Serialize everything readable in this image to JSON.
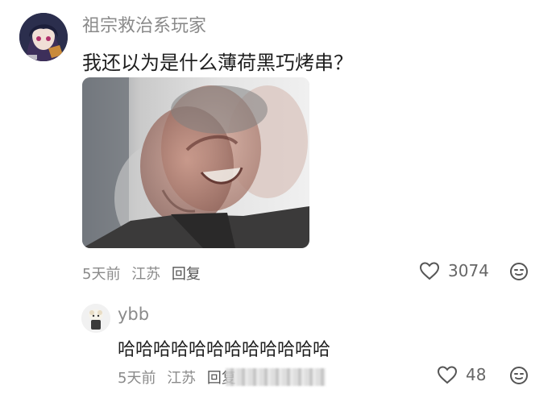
{
  "comment": {
    "username": "祖宗救治系玩家",
    "text": "我还以为是什么薄荷黑巧烤串？",
    "time": "5天前",
    "location": "江苏",
    "reply_label": "回复",
    "like_count": "3074",
    "avatar_icon": "anime-avatar",
    "image_icon": "meme-image"
  },
  "reply": {
    "username": "ybb",
    "text": "哈哈哈哈哈哈哈哈哈哈哈哈",
    "time": "5天前",
    "location": "江苏",
    "reply_label": "回复",
    "like_count": "48",
    "avatar_icon": "user-avatar"
  },
  "icons": {
    "like": "heart-icon",
    "emoji": "emoji-reaction-icon"
  }
}
